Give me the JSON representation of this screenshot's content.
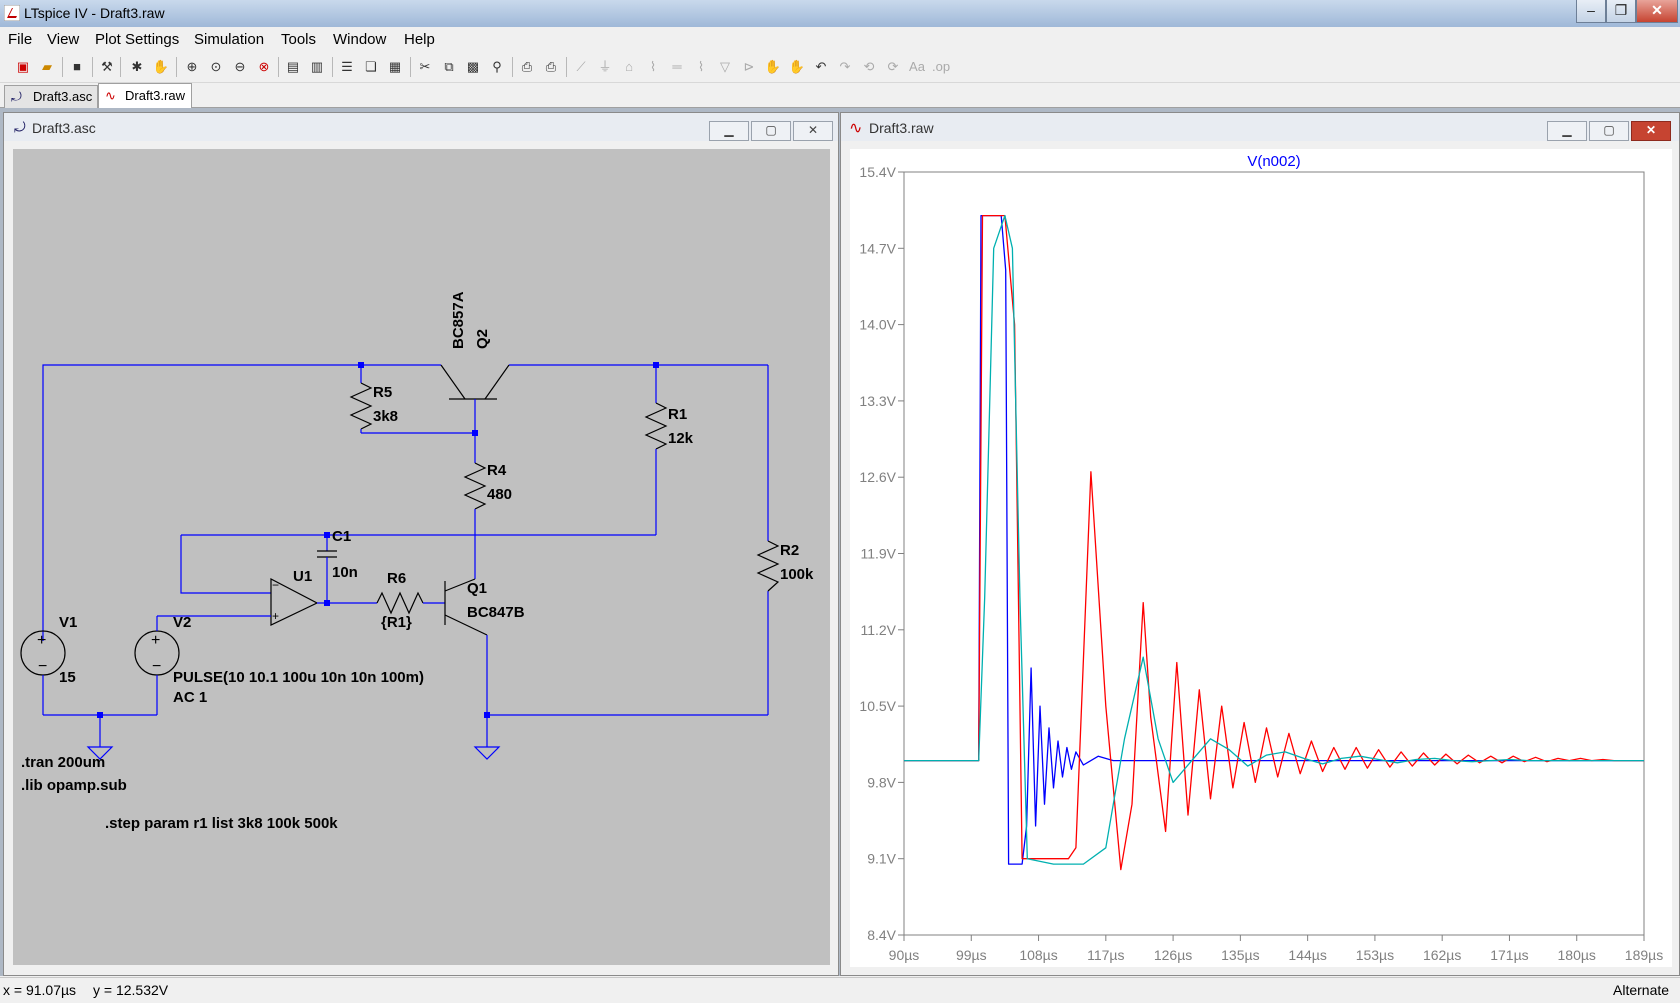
{
  "app": {
    "title": "LTspice IV - Draft3.raw"
  },
  "menu": [
    "File",
    "View",
    "Plot Settings",
    "Simulation",
    "Tools",
    "Window",
    "Help"
  ],
  "tabs": [
    "Draft3.asc",
    "Draft3.raw"
  ],
  "schematic_window": {
    "title": "Draft3.asc"
  },
  "schematic": {
    "r5": {
      "name": "R5",
      "value": "3k8"
    },
    "r4": {
      "name": "R4",
      "value": "480"
    },
    "r1": {
      "name": "R1",
      "value": "12k"
    },
    "r2": {
      "name": "R2",
      "value": "100k"
    },
    "r6": {
      "name": "R6",
      "value": "{R1}"
    },
    "c1": {
      "name": "C1",
      "value": "10n"
    },
    "q1": {
      "name": "Q1",
      "model": "BC847B"
    },
    "q2": {
      "name": "Q2",
      "model": "BC857A"
    },
    "u1": {
      "name": "U1"
    },
    "v1": {
      "name": "V1",
      "value": "15"
    },
    "v2": {
      "name": "V2",
      "value": "PULSE(10 10.1 100u 10n 10n 100m)",
      "ac": "AC 1"
    },
    "directives": [
      ".tran 200um",
      ".lib opamp.sub",
      ".step param r1 list 3k8 100k 500k"
    ]
  },
  "waveform_window": {
    "title": "Draft3.raw"
  },
  "chart_data": {
    "type": "line",
    "title": "V(n002)",
    "xlabel": "",
    "ylabel": "",
    "xlim": [
      90,
      189
    ],
    "ylim": [
      8.4,
      15.4
    ],
    "x_unit": "µs",
    "y_unit": "V",
    "x_ticks": [
      "90µs",
      "99µs",
      "108µs",
      "117µs",
      "126µs",
      "135µs",
      "144µs",
      "153µs",
      "162µs",
      "171µs",
      "180µs",
      "189µs"
    ],
    "y_ticks": [
      "15.4V",
      "14.7V",
      "14.0V",
      "13.3V",
      "12.6V",
      "11.9V",
      "11.2V",
      "10.5V",
      "9.8V",
      "9.1V",
      "8.4V"
    ],
    "grid": false,
    "series": [
      {
        "color": "#0000ff",
        "x": [
          90,
          100,
          100.3,
          103,
          103.6,
          104,
          105.8,
          106.4,
          107.0,
          107.6,
          108.2,
          108.8,
          109.4,
          110.0,
          110.6,
          111.2,
          111.8,
          112.4,
          113,
          114,
          116,
          118,
          120,
          189
        ],
        "y": [
          10.0,
          10.0,
          15.0,
          15.0,
          14.5,
          9.05,
          9.05,
          9.4,
          10.85,
          9.4,
          10.5,
          9.6,
          10.3,
          9.75,
          10.18,
          9.85,
          10.12,
          9.92,
          10.08,
          9.96,
          10.04,
          10.0,
          10.0,
          10.0
        ]
      },
      {
        "color": "#ff0000",
        "x": [
          90,
          100,
          100.5,
          103.5,
          104.8,
          105.8,
          112,
          113,
          115,
          117,
          119,
          120.5,
          122,
          123,
          125,
          126.5,
          128,
          129.5,
          131,
          132.5,
          134,
          135.5,
          137,
          138.5,
          140,
          141.5,
          143,
          144.5,
          146,
          147.5,
          149,
          150.5,
          152,
          153.5,
          155,
          156.5,
          158,
          159.5,
          161,
          162.5,
          164,
          165.5,
          167,
          168.5,
          170,
          171.5,
          173,
          174.5,
          176,
          177.5,
          179,
          180.5,
          182,
          183.5,
          185,
          186.5,
          189
        ],
        "y": [
          10.0,
          10.0,
          15.0,
          15.0,
          14.0,
          9.1,
          9.1,
          9.2,
          12.65,
          10.5,
          9.0,
          9.6,
          11.45,
          10.4,
          9.35,
          10.9,
          9.5,
          10.65,
          9.65,
          10.5,
          9.75,
          10.35,
          9.8,
          10.3,
          9.85,
          10.25,
          9.88,
          10.18,
          9.9,
          10.12,
          9.92,
          10.12,
          9.93,
          10.1,
          9.94,
          10.08,
          9.95,
          10.07,
          9.96,
          10.06,
          9.97,
          10.05,
          9.98,
          10.04,
          9.98,
          10.04,
          9.99,
          10.03,
          9.99,
          10.02,
          10.0,
          10.02,
          10.0,
          10.01,
          10.0,
          10.0,
          10.0
        ]
      },
      {
        "color": "#00b0b0",
        "x": [
          90,
          100,
          100.8,
          102,
          103.5,
          104.5,
          105.5,
          106.5,
          110,
          114,
          117,
          119.5,
          122,
          124,
          126,
          128.5,
          131,
          133.5,
          136,
          138.5,
          141,
          143.5,
          146,
          148.5,
          151,
          153.5,
          156,
          158.5,
          161,
          163.5,
          166,
          168.5,
          171,
          173.5,
          176,
          178.5,
          181,
          183.5,
          186,
          189
        ],
        "y": [
          10.0,
          10.0,
          11.5,
          14.7,
          15.0,
          14.7,
          11.5,
          9.1,
          9.05,
          9.05,
          9.2,
          10.2,
          10.95,
          10.2,
          9.8,
          10.0,
          10.2,
          10.1,
          9.95,
          10.05,
          10.08,
          10.02,
          9.97,
          10.02,
          10.04,
          10.01,
          9.98,
          10.01,
          10.02,
          10.0,
          9.99,
          10.0,
          10.01,
          10.0,
          10.0,
          10.0,
          10.0,
          10.0,
          10.0,
          10.0
        ]
      }
    ]
  },
  "status": {
    "x": "x = 91.07µs",
    "y": "y = 12.532V",
    "mode": "Alternate"
  }
}
